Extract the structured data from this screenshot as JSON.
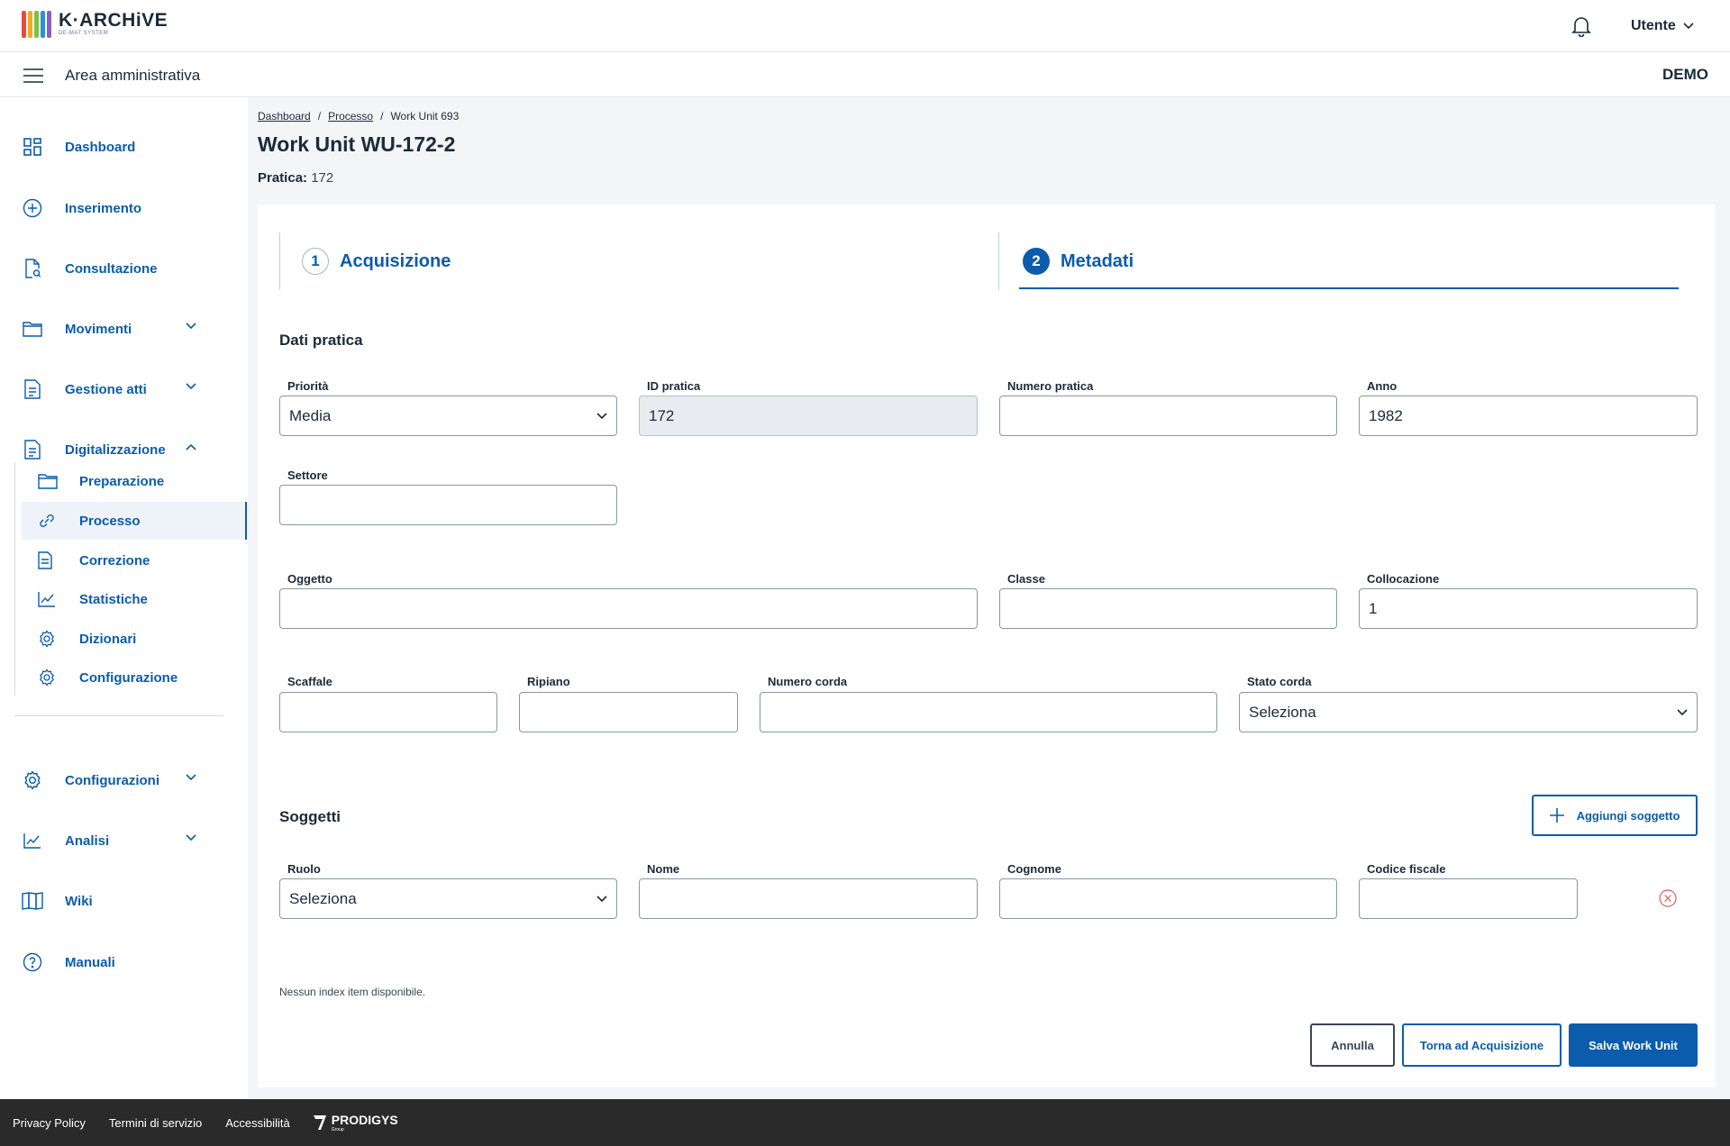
{
  "header": {
    "logo_text": "K·ARCHiVE",
    "logo_sub": "DE-MAT SYSTEM",
    "user_label": "Utente",
    "logo_colors": [
      "#e8493f",
      "#f5a623",
      "#7cc242",
      "#2f8fd8",
      "#8b5fbf"
    ]
  },
  "subbar": {
    "area_title": "Area amministrativa",
    "environment": "DEMO"
  },
  "sidebar": {
    "items": [
      {
        "label": "Dashboard",
        "icon": "dashboard-icon"
      },
      {
        "label": "Inserimento",
        "icon": "plus-circle-icon"
      },
      {
        "label": "Consultazione",
        "icon": "document-search-icon"
      },
      {
        "label": "Movimenti",
        "icon": "folder-icon"
      },
      {
        "label": "Gestione atti",
        "icon": "document-icon"
      },
      {
        "label": "Digitalizzazione",
        "icon": "document-icon"
      },
      {
        "label": "Configurazioni",
        "icon": "gear-icon"
      },
      {
        "label": "Analisi",
        "icon": "chart-icon"
      },
      {
        "label": "Wiki",
        "icon": "book-icon"
      },
      {
        "label": "Manuali",
        "icon": "help-icon"
      }
    ],
    "sub_items": [
      {
        "label": "Preparazione",
        "icon": "folder-icon"
      },
      {
        "label": "Processo",
        "icon": "link-icon"
      },
      {
        "label": "Correzione",
        "icon": "document-icon"
      },
      {
        "label": "Statistiche",
        "icon": "chart-icon"
      },
      {
        "label": "Dizionari",
        "icon": "gear-icon"
      },
      {
        "label": "Configurazione",
        "icon": "gear-icon"
      }
    ]
  },
  "breadcrumb": {
    "items": [
      "Dashboard",
      "Processo"
    ],
    "current": "Work Unit 693",
    "separator": "/"
  },
  "page": {
    "title": "Work Unit WU-172-2",
    "pratica_label": "Pratica:",
    "pratica_value": "172"
  },
  "steps": [
    {
      "number": "1",
      "label": "Acquisizione"
    },
    {
      "number": "2",
      "label": "Metadati"
    }
  ],
  "dati_pratica": {
    "title": "Dati pratica",
    "fields": {
      "priorita": {
        "label": "Priorità",
        "value": "Media"
      },
      "id_pratica": {
        "label": "ID pratica",
        "value": "172"
      },
      "numero_pratica": {
        "label": "Numero pratica",
        "value": ""
      },
      "anno": {
        "label": "Anno",
        "value": "1982"
      },
      "settore": {
        "label": "Settore",
        "value": ""
      },
      "oggetto": {
        "label": "Oggetto",
        "value": ""
      },
      "classe": {
        "label": "Classe",
        "value": ""
      },
      "collocazione": {
        "label": "Collocazione",
        "value": "1"
      },
      "scaffale": {
        "label": "Scaffale",
        "value": ""
      },
      "ripiano": {
        "label": "Ripiano",
        "value": ""
      },
      "numero_corda": {
        "label": "Numero corda",
        "value": ""
      },
      "stato_corda": {
        "label": "Stato corda",
        "value": "Seleziona"
      }
    }
  },
  "soggetti": {
    "title": "Soggetti",
    "add_button": "Aggiungi soggetto",
    "fields": {
      "ruolo": {
        "label": "Ruolo",
        "value": "Seleziona"
      },
      "nome": {
        "label": "Nome",
        "value": ""
      },
      "cognome": {
        "label": "Cognome",
        "value": ""
      },
      "codice_fiscale": {
        "label": "Codice fiscale",
        "value": ""
      }
    }
  },
  "index_empty": "Nessun index item disponibile.",
  "actions": {
    "cancel": "Annulla",
    "back": "Torna ad Acquisizione",
    "save": "Salva Work Unit"
  },
  "footer": {
    "links": [
      "Privacy Policy",
      "Termini di servizio",
      "Accessibilità"
    ],
    "brand": "PRODIGYS",
    "brand_sub": "Group"
  }
}
